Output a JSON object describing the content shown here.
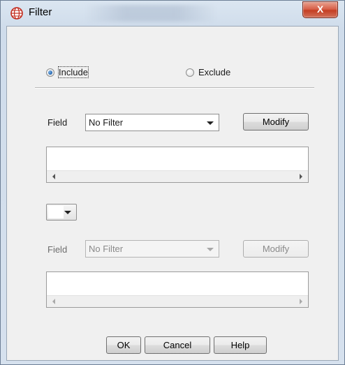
{
  "window": {
    "title": "Filter",
    "close_label": "X"
  },
  "mode": {
    "include_label": "Include",
    "exclude_label": "Exclude",
    "selected": "include"
  },
  "filter1": {
    "field_label": "Field",
    "value": "No Filter",
    "modify_label": "Modify"
  },
  "conjunction": {
    "value": ""
  },
  "filter2": {
    "field_label": "Field",
    "value": "No Filter",
    "modify_label": "Modify"
  },
  "footer": {
    "ok_label": "OK",
    "cancel_label": "Cancel",
    "help_label": "Help"
  }
}
